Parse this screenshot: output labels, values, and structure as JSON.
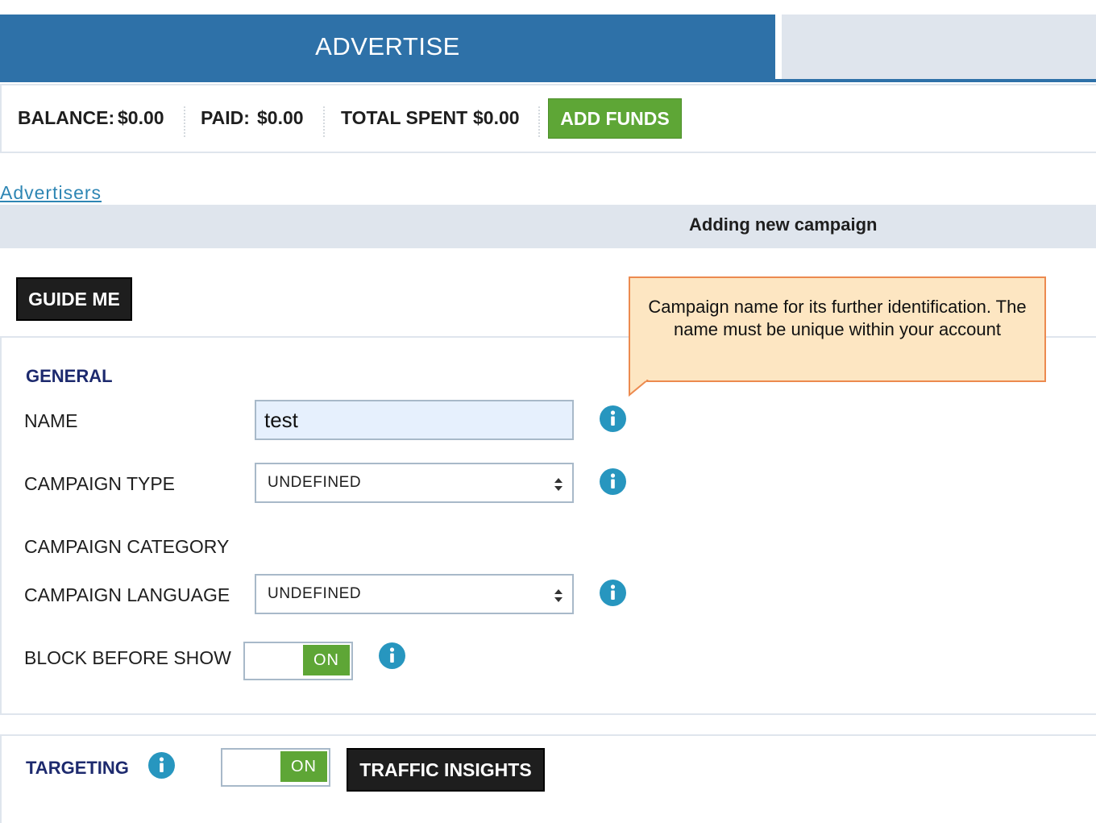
{
  "tabs": {
    "advertise_label": "ADVERTISE"
  },
  "balance": {
    "balance_label": "BALANCE:",
    "balance_value": "$0.00",
    "paid_label": "PAID:",
    "paid_value": "$0.00",
    "total_spent_label": "TOTAL SPENT",
    "total_spent_value": "$0.00",
    "add_funds_label": "ADD FUNDS"
  },
  "breadcrumb": {
    "advertisers_link": "Advertisers"
  },
  "page_title": "Adding new campaign",
  "guide_me_label": "GUIDE ME",
  "tooltip": {
    "text": "Campaign name for its further identification. The name must be unique within your account"
  },
  "general": {
    "title": "GENERAL",
    "name_label": "NAME",
    "name_value": "test",
    "campaign_type_label": "CAMPAIGN TYPE",
    "campaign_type_value": "UNDEFINED",
    "campaign_category_label": "CAMPAIGN CATEGORY",
    "campaign_language_label": "CAMPAIGN LANGUAGE",
    "campaign_language_value": "UNDEFINED",
    "block_before_show_label": "BLOCK BEFORE SHOW",
    "block_before_show_state": "ON"
  },
  "targeting": {
    "title": "TARGETING",
    "toggle_state": "ON",
    "traffic_insights_label": "TRAFFIC INSIGHTS"
  },
  "colors": {
    "primary_blue": "#2e71a8",
    "tab_inactive": "#dfe5ed",
    "success_green": "#5ea636",
    "info_blue": "#2796bf",
    "section_title": "#1d2a6e",
    "tooltip_bg": "#fde6c2",
    "tooltip_border": "#ec8a4f"
  },
  "icons": [
    "info-icon",
    "select-arrows-icon"
  ]
}
